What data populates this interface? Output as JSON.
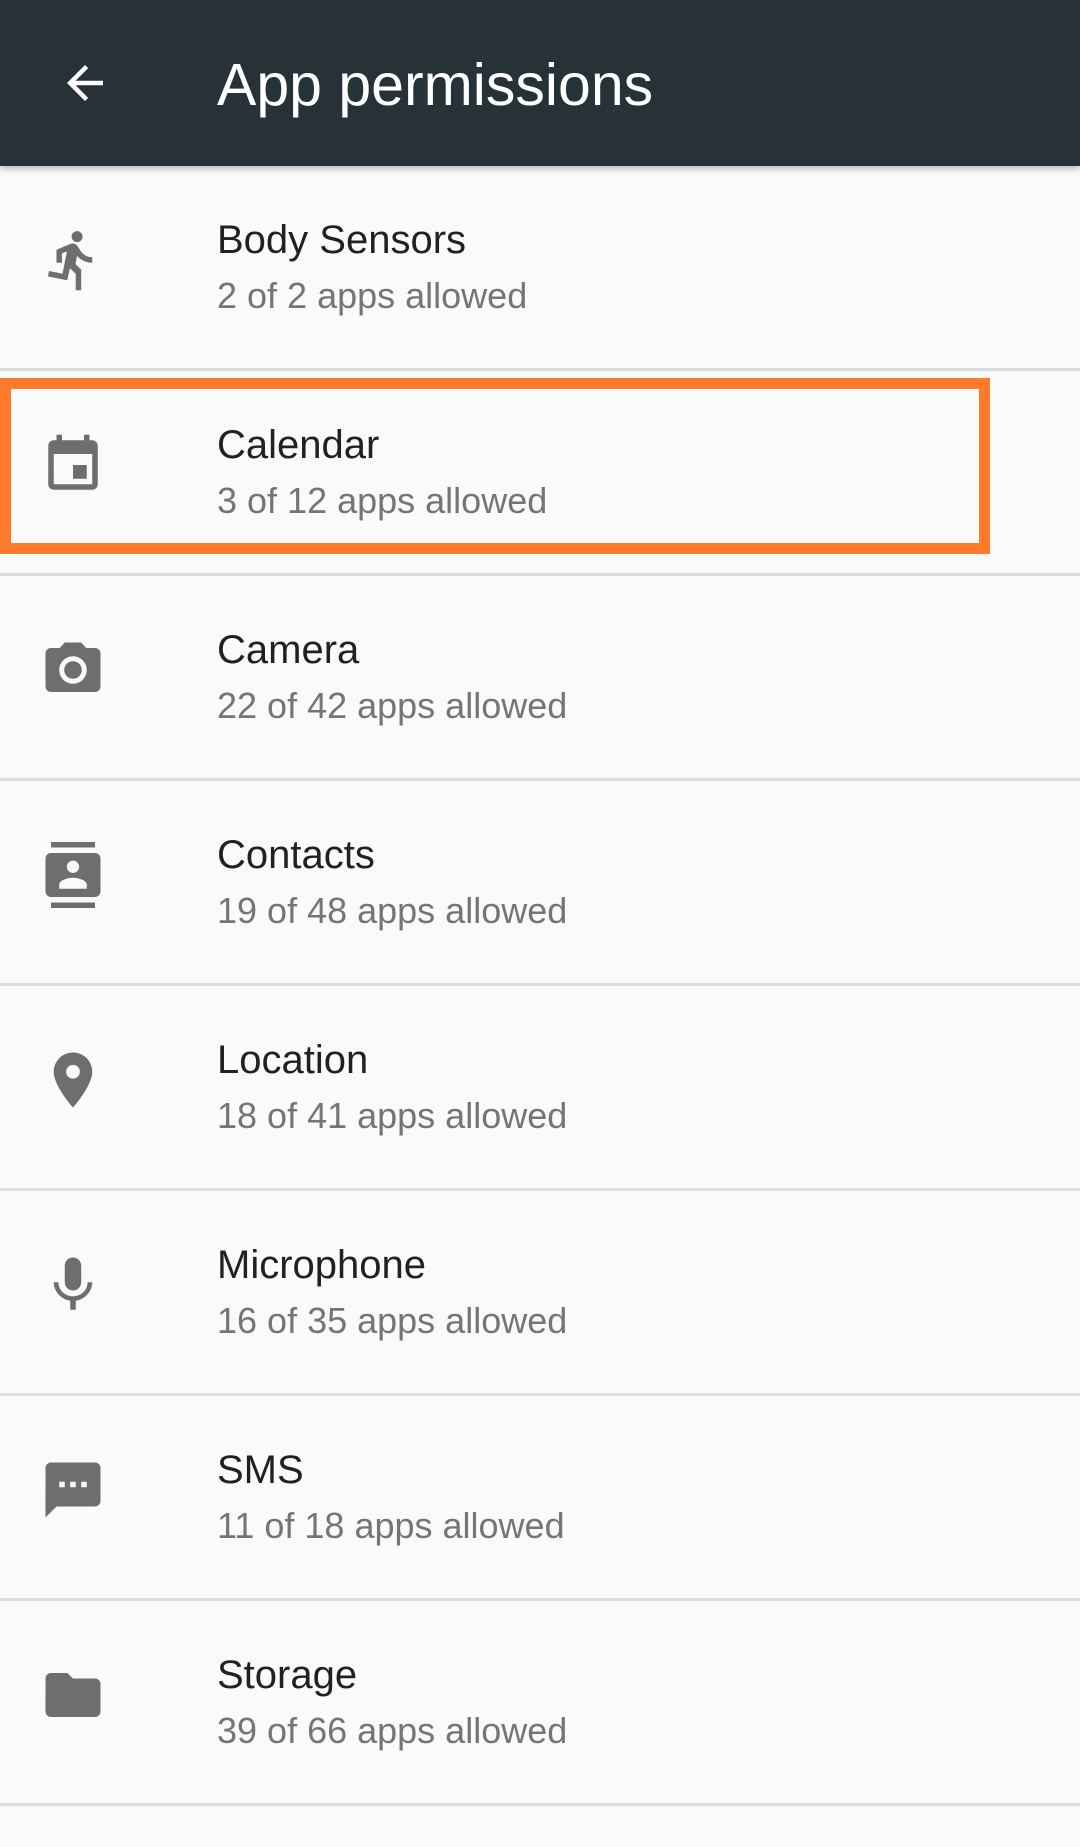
{
  "app_bar": {
    "title": "App permissions",
    "back_icon": "arrow-back-icon",
    "background": "#263238"
  },
  "permissions": [
    {
      "icon": "running-person-icon",
      "label": "Body Sensors",
      "summary": "2 of 2 apps allowed"
    },
    {
      "icon": "calendar-icon",
      "label": "Calendar",
      "summary": "3 of 12 apps allowed"
    },
    {
      "icon": "camera-icon",
      "label": "Camera",
      "summary": "22 of 42 apps allowed"
    },
    {
      "icon": "contacts-icon",
      "label": "Contacts",
      "summary": "19 of 48 apps allowed"
    },
    {
      "icon": "location-pin-icon",
      "label": "Location",
      "summary": "18 of 41 apps allowed"
    },
    {
      "icon": "microphone-icon",
      "label": "Microphone",
      "summary": "16 of 35 apps allowed"
    },
    {
      "icon": "sms-icon",
      "label": "SMS",
      "summary": "11 of 18 apps allowed"
    },
    {
      "icon": "folder-icon",
      "label": "Storage",
      "summary": "39 of 66 apps allowed"
    }
  ],
  "highlight": {
    "target": "Calendar",
    "color": "#ff7a2b"
  }
}
